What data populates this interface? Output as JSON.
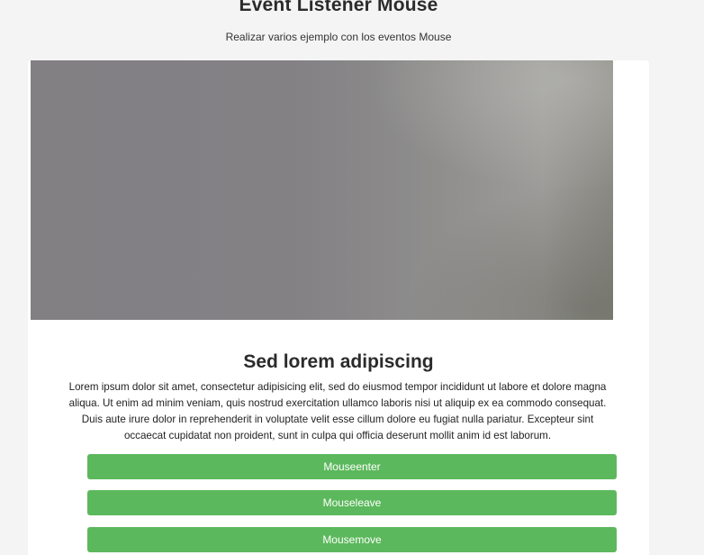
{
  "header": {
    "title": "Event Listener Mouse",
    "subtitle": "Realizar varios ejemplo con los eventos Mouse"
  },
  "card": {
    "heading": "Sed lorem adipiscing",
    "text": "Lorem ipsum dolor sit amet, consectetur adipisicing elit, sed do eiusmod tempor incididunt ut labore et dolore magna aliqua. Ut enim ad minim veniam, quis nostrud exercitation ullamco laboris nisi ut aliquip ex ea commodo consequat. Duis aute irure dolor in reprehenderit in voluptate velit esse cillum dolore eu fugiat nulla pariatur. Excepteur sint occaecat cupidatat non proident, sunt in culpa qui officia deserunt mollit anim id est laborum.",
    "buttons": [
      {
        "label": "Mouseenter"
      },
      {
        "label": "Mouseleave"
      },
      {
        "label": "Mousemove"
      }
    ]
  },
  "colors": {
    "button_bg": "#5cb85c",
    "button_text": "#ffffff",
    "page_bg": "#f4f4f4",
    "card_bg": "#ffffff"
  }
}
